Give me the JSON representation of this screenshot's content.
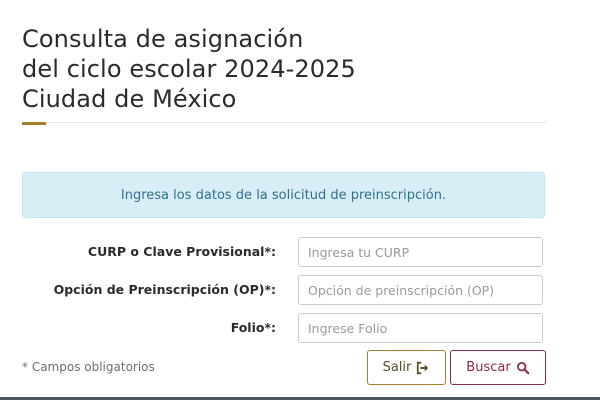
{
  "header": {
    "title_lines": [
      "Consulta de asignación",
      "del ciclo escolar 2024-2025",
      "Ciudad de México"
    ]
  },
  "alert": {
    "text": "Ingresa los datos de la solicitud de preinscripción."
  },
  "form": {
    "fields": [
      {
        "label": "CURP o Clave Provisional*:",
        "placeholder": "Ingresa tu CURP",
        "value": ""
      },
      {
        "label": "Opción de Preinscripción (OP)*:",
        "placeholder": "Opción de preinscripción (OP)",
        "value": ""
      },
      {
        "label": "Folio*:",
        "placeholder": "Ingrese Folio",
        "value": ""
      }
    ],
    "required_note": "* Campos obligatorios"
  },
  "buttons": {
    "exit_label": "Salir",
    "exit_icon": "sign-out-icon",
    "search_label": "Buscar",
    "search_icon": "search-icon"
  },
  "colors": {
    "accent_gold": "#a57f2c",
    "accent_wine": "#8c2a4a",
    "info_bg": "#d9edf7",
    "info_text": "#31708f"
  }
}
